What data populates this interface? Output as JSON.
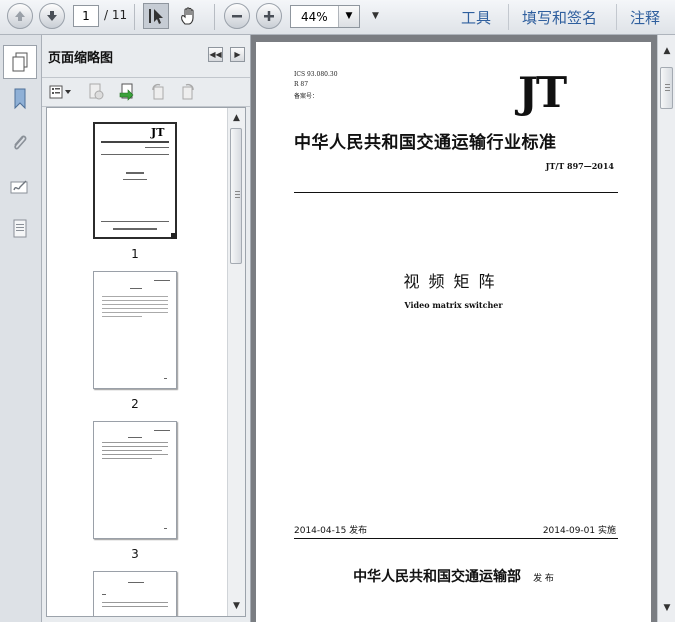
{
  "toolbar": {
    "page_current": "1",
    "page_total": "/ 11",
    "zoom_value": "44%",
    "links": [
      "工具",
      "填写和签名",
      "注释"
    ]
  },
  "panel": {
    "title": "页面缩略图",
    "thumb_labels": [
      "1",
      "2",
      "3"
    ]
  },
  "document": {
    "ics": "ICS 93.080.30",
    "r_code": "R 87",
    "record_no": "备案号：",
    "logo": "JT",
    "standard_title": "中华人民共和国交通运输行业标准",
    "standard_code": "JT/T 897—2014",
    "title_cn": "视频矩阵",
    "title_en": "Video matrix switcher",
    "publish_date": "2014-04-15 发布",
    "implement_date": "2014-09-01 实施",
    "issuer": "中华人民共和国交通运输部",
    "issuer_suffix": "发 布"
  },
  "icons": {
    "prev_page": "up-arrow-icon",
    "next_page": "down-arrow-icon",
    "select_tool": "cursor-icon",
    "hand_tool": "hand-icon",
    "zoom_out": "minus-icon",
    "zoom_in": "plus-icon"
  },
  "colors": {
    "link": "#2f5f9e",
    "doc_background": "#7a7d82"
  }
}
